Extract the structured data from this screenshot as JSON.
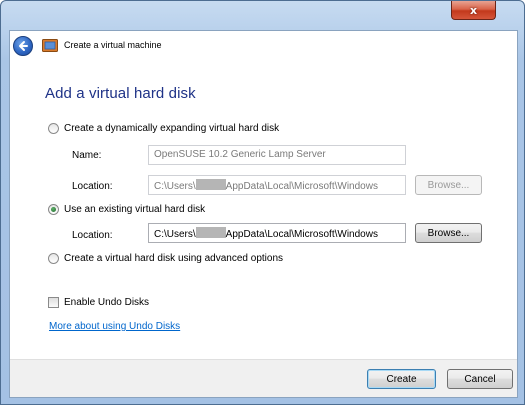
{
  "window": {
    "close_glyph": "x",
    "title": "Create a virtual machine"
  },
  "page": {
    "heading": "Add a virtual hard disk"
  },
  "options": {
    "dynamic": {
      "label": "Create a dynamically expanding virtual hard disk",
      "selected": false,
      "name_label": "Name:",
      "name_value": "OpenSUSE 10.2 Generic Lamp Server",
      "location_label": "Location:",
      "location_prefix": "C:\\Users\\",
      "location_suffix": "AppData\\Local\\Microsoft\\Windows",
      "browse_label": "Browse..."
    },
    "existing": {
      "label": "Use an existing virtual hard disk",
      "selected": true,
      "location_label": "Location:",
      "location_prefix": "C:\\Users\\",
      "location_suffix": "AppData\\Local\\Microsoft\\Windows",
      "browse_label": "Browse..."
    },
    "advanced": {
      "label": "Create a virtual hard disk using advanced options",
      "selected": false
    }
  },
  "undo": {
    "checkbox_label": "Enable Undo Disks",
    "checked": false,
    "link_text": "More about using Undo Disks"
  },
  "footer": {
    "create_label": "Create",
    "cancel_label": "Cancel"
  },
  "colors": {
    "heading": "#1e3287",
    "link": "#0066cc",
    "frame": "#a9c5e6"
  }
}
